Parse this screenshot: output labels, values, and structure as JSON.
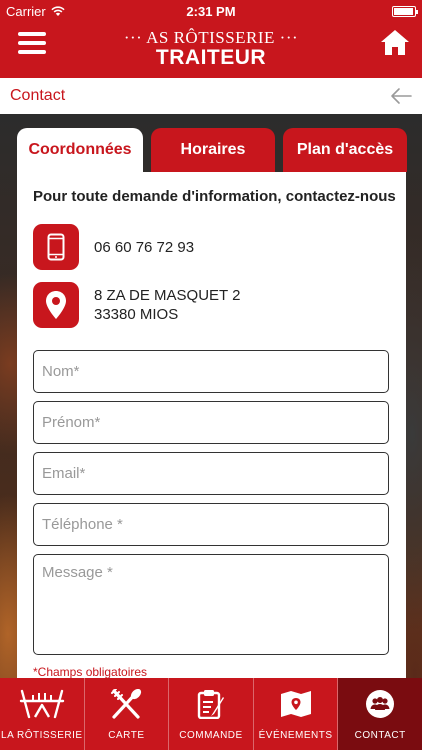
{
  "status_bar": {
    "carrier": "Carrier",
    "time": "2:31 PM",
    "battery_level": 0.95
  },
  "header": {
    "logo_top": "··· AS RÔTISSERIE ···",
    "logo_bottom": "TRAITEUR",
    "menu_icon": "hamburger-icon",
    "home_icon": "home-icon"
  },
  "breadcrumb": {
    "label": "Contact",
    "back_icon": "arrow-left-icon"
  },
  "tabs": [
    {
      "label": "Coordonnées",
      "active": true
    },
    {
      "label": "Horaires",
      "active": false
    },
    {
      "label": "Plan d'accès",
      "active": false
    }
  ],
  "contact": {
    "intro": "Pour toute demande d'information, contactez-nous",
    "phone": "06 60 76 72 93",
    "phone_icon": "phone-icon",
    "address_line1": "8 ZA DE MASQUET 2",
    "address_line2": "33380 MIOS",
    "address_icon": "map-pin-icon"
  },
  "form": {
    "nom_placeholder": "Nom*",
    "prenom_placeholder": "Prénom*",
    "email_placeholder": "Email*",
    "telephone_placeholder": "Téléphone *",
    "message_placeholder": "Message *",
    "required_note": "*Champs obligatoires"
  },
  "bottom_nav": [
    {
      "label": "LA RÔTISSERIE",
      "icon": "rotisserie-icon"
    },
    {
      "label": "CARTE",
      "icon": "utensils-icon"
    },
    {
      "label": "COMMANDE",
      "icon": "clipboard-icon"
    },
    {
      "label": "ÉVÉNEMENTS",
      "icon": "event-map-icon"
    },
    {
      "label": "CONTACT",
      "icon": "contact-people-icon",
      "active": true
    }
  ],
  "colors": {
    "brand_red": "#c8161d",
    "active_nav": "#7a0c10"
  }
}
